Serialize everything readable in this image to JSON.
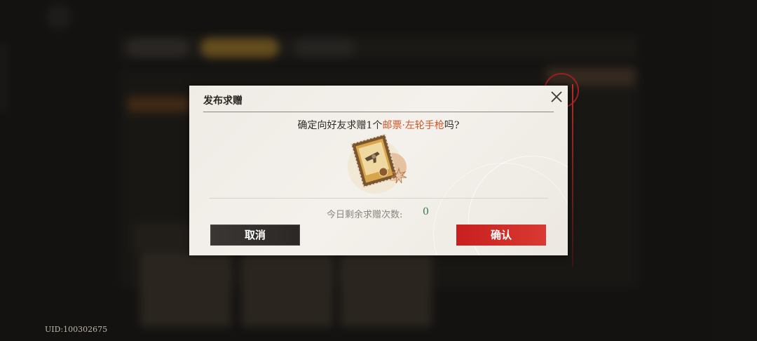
{
  "dialog": {
    "title": "发布求赠",
    "message_prefix": "确定向好友求赠1个",
    "item_name": "邮票·左轮手枪",
    "message_suffix": "吗?",
    "remaining_label": "今日剩余求赠次数:",
    "remaining_value": "0",
    "cancel_label": "取消",
    "confirm_label": "确认",
    "item_icon": "stamp-revolver-icon",
    "highlight_color": "#d0572a",
    "confirm_color": "#d02a26"
  },
  "footer": {
    "uid": "UID:100302675"
  }
}
